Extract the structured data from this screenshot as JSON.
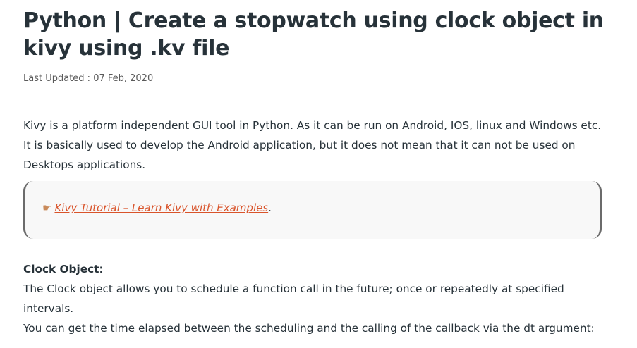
{
  "article": {
    "title": "Python | Create a stopwatch using clock object in kivy using .kv file",
    "last_updated": "Last Updated : 07 Feb, 2020",
    "intro": "Kivy is a platform independent GUI tool in Python. As it can be run on Android, IOS, linux and Windows etc. It is basically used to develop the Android application, but it does not mean that it can not be used on Desktops applications.",
    "callout": {
      "icon": "pointing-hand-icon",
      "link_text": "Kivy Tutorial – Learn Kivy with Examples",
      "suffix": "."
    },
    "section_heading": "Clock Object:",
    "section_para1": "The Clock object allows you to schedule a function call in the future; once or repeatedly at specified intervals.",
    "section_para2": "You can get the time elapsed between the scheduling and the calling of the callback via the dt argument:"
  },
  "colors": {
    "text": "#273239",
    "link": "#d9542b",
    "callout_bg": "#f8f8f8",
    "callout_border": "#6b6b6b"
  }
}
